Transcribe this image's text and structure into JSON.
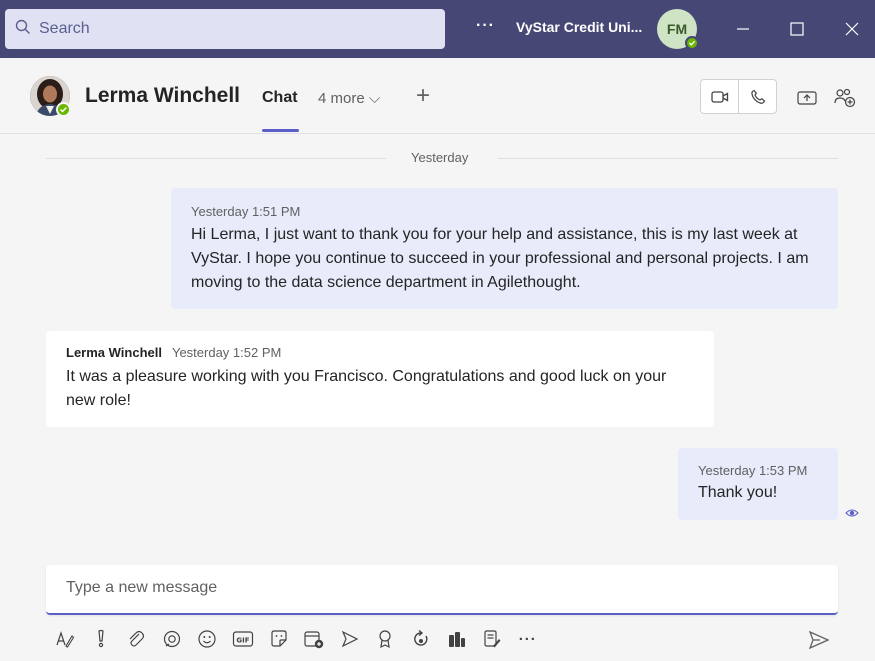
{
  "titlebar": {
    "search_placeholder": "Search",
    "more_label": "···",
    "org_name": "VyStar Credit Uni...",
    "user_initials": "FM"
  },
  "chat_header": {
    "contact_name": "Lerma Winchell",
    "tab_chat": "Chat",
    "tab_more": "4 more ⌵",
    "tab_add": "+"
  },
  "messages": {
    "divider_label": "Yesterday",
    "items": [
      {
        "sender": "",
        "time": "Yesterday 1:51 PM",
        "text": "Hi Lerma, I just want to thank you for your help and assistance, this is my last week at VyStar. I hope you continue to succeed in your professional and personal projects. I am moving to the data science department in Agilethought."
      },
      {
        "sender": "Lerma Winchell",
        "time": "Yesterday 1:52 PM",
        "text": "It was a pleasure working with you Francisco. Congratulations and good luck on your new role!"
      },
      {
        "sender": "",
        "time": "Yesterday 1:53 PM",
        "text": "Thank you!"
      }
    ]
  },
  "compose": {
    "placeholder": "Type a new message",
    "more_label": "···"
  },
  "colors": {
    "titlebar": "#464775",
    "accent": "#5b5fc7",
    "my_bubble": "#e8ebfa",
    "presence_available": "#6bb700"
  },
  "icons": [
    "search-icon",
    "video-call-icon",
    "audio-call-icon",
    "share-screen-icon",
    "add-people-icon",
    "format-icon",
    "important-icon",
    "attach-icon",
    "loop-icon",
    "emoji-icon",
    "gif-icon",
    "sticker-icon",
    "schedule-meeting-icon",
    "stream-icon",
    "praise-icon",
    "updates-icon",
    "viva-icon",
    "forms-icon",
    "send-icon",
    "read-receipt-icon"
  ]
}
